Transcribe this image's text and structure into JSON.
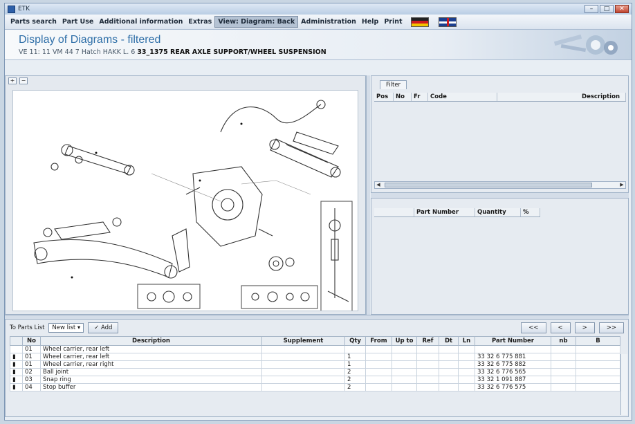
{
  "window": {
    "title": "ETK",
    "buttons": [
      "–",
      "□",
      "✕"
    ]
  },
  "menu": {
    "items": [
      "Parts search",
      "Part Use",
      "Additional information",
      "Extras",
      "View: Diagram: Back",
      "Administration",
      "Help",
      "Print"
    ],
    "active_index": 4
  },
  "header": {
    "title": "Display of Diagrams - filtered",
    "subtitle_prefix": "VE 11: 11 VM 44 7 Hatch HAKK L. 6",
    "subtitle_group": "33_1375 REAR AXLE SUPPORT/WHEEL SUSPENSION"
  },
  "diagram": {
    "zoom_in_label": "+",
    "zoom_out_label": "−"
  },
  "filter_pane": {
    "tab_label": "Filter",
    "columns": [
      "Pos",
      "No",
      "Fr",
      "Code",
      "Description"
    ]
  },
  "cart_pane": {
    "columns": [
      "",
      "Part Number",
      "Quantity",
      "%"
    ]
  },
  "parts_list": {
    "list_label": "To Parts List",
    "select_value": "New list",
    "add_label": "Add",
    "nav_buttons": [
      "<<",
      "<",
      ">",
      ">>"
    ],
    "columns": [
      "",
      "No",
      "Description",
      "Supplement",
      "Qty",
      "From",
      "Up to",
      "Ref",
      "Dt",
      "Ln",
      "Part Number",
      "nb",
      "B"
    ],
    "rows": [
      {
        "no": "01",
        "description": "Wheel carrier, rear left",
        "supplement": "",
        "qty": "",
        "part_number": ""
      },
      {
        "no": "01",
        "description": "Wheel carrier, rear left",
        "supplement": "",
        "qty": "1",
        "part_number": "33 32 6 775 881"
      },
      {
        "no": "01",
        "description": "Wheel carrier, rear right",
        "supplement": "",
        "qty": "1",
        "part_number": "33 32 6 775 882"
      },
      {
        "no": "02",
        "description": "Ball joint",
        "supplement": "",
        "qty": "2",
        "part_number": "33 32 6 776 565"
      },
      {
        "no": "03",
        "description": "Snap ring",
        "supplement": "",
        "qty": "2",
        "part_number": "33 32 1 091 887"
      },
      {
        "no": "04",
        "description": "Stop buffer",
        "supplement": "",
        "qty": "2",
        "part_number": "33 32 6 776 575"
      }
    ]
  },
  "colors": {
    "accent": "#2f6fa8",
    "window_bg": "#e8eef4",
    "frame": "#7f98b6"
  }
}
